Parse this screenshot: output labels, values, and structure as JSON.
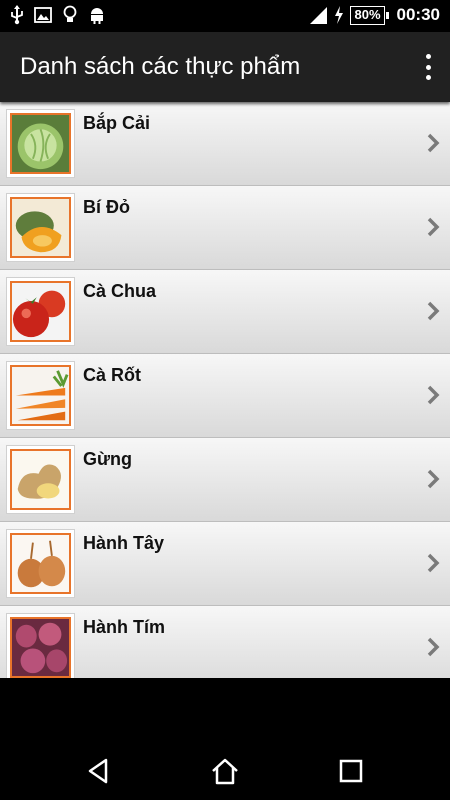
{
  "status": {
    "battery": "80%",
    "time": "00:30",
    "icons": [
      "usb-icon",
      "image-icon",
      "lightbulb-icon",
      "android-icon",
      "signal-icon",
      "charging-icon",
      "battery-icon"
    ]
  },
  "app_bar": {
    "title": "Danh sách các thực phẩm",
    "menu_icon": "more-vert-icon"
  },
  "items": [
    {
      "label": "Bắp Cải",
      "image": "cabbage"
    },
    {
      "label": "Bí Đỏ",
      "image": "pumpkin"
    },
    {
      "label": "Cà Chua",
      "image": "tomato"
    },
    {
      "label": "Cà Rốt",
      "image": "carrot"
    },
    {
      "label": "Gừng",
      "image": "ginger"
    },
    {
      "label": "Hành Tây",
      "image": "onion"
    },
    {
      "label": "Hành Tím",
      "image": "shallot"
    }
  ],
  "nav": {
    "back": "back-icon",
    "home": "home-icon",
    "recents": "recents-icon"
  },
  "colors": {
    "app_bar": "#212121",
    "thumb_border": "#e8742a"
  }
}
